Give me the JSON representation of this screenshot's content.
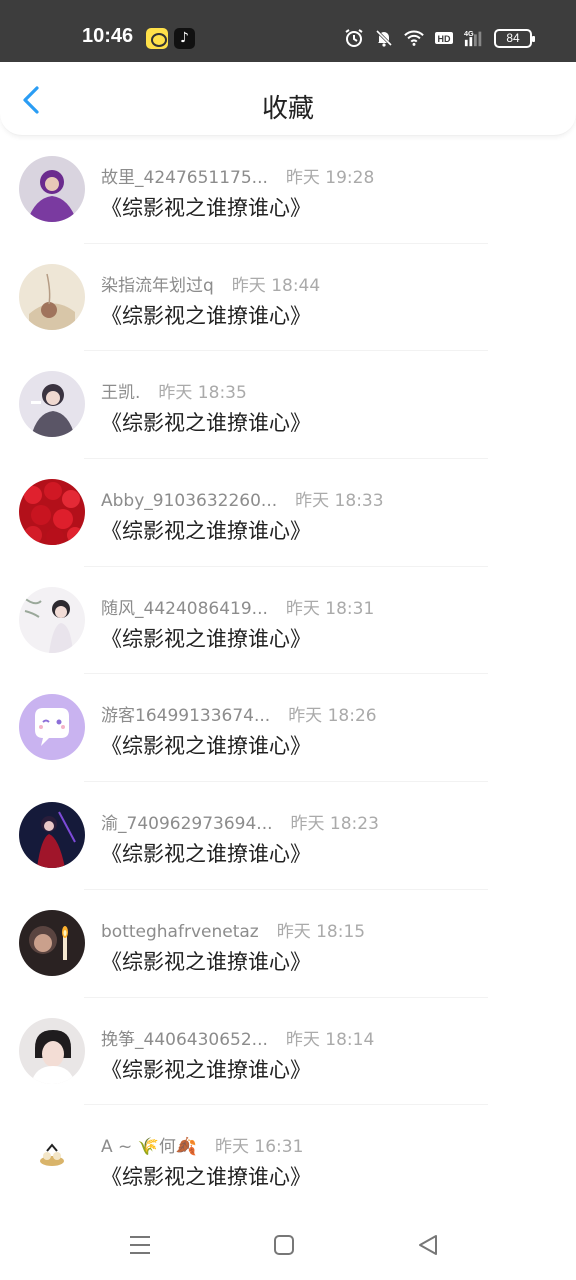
{
  "status_bar": {
    "time": "10:46",
    "battery": "84",
    "icons": [
      "notes-app-icon",
      "tiktok-icon",
      "alarm-icon",
      "mute-bell-icon",
      "wifi-icon",
      "hd-icon",
      "signal-4g-icon",
      "battery-icon"
    ]
  },
  "header": {
    "title": "收藏",
    "back_icon": "chevron-left-icon"
  },
  "colors": {
    "accent": "#2a9df4",
    "status_bar_bg": "#3d3d3d",
    "username": "#8c8c8c",
    "time": "#aaaaaa",
    "title_text": "#222222"
  },
  "items": [
    {
      "username": "故里_4247651175...",
      "time": "昨天 19:28",
      "title": "《综影视之谁撩谁心》"
    },
    {
      "username": "染指流年划过q",
      "time": "昨天 18:44",
      "title": "《综影视之谁撩谁心》"
    },
    {
      "username": "王凯.",
      "time": "昨天 18:35",
      "title": "《综影视之谁撩谁心》"
    },
    {
      "username": "Abby_9103632260...",
      "time": "昨天 18:33",
      "title": "《综影视之谁撩谁心》"
    },
    {
      "username": "随风_4424086419...",
      "time": "昨天 18:31",
      "title": "《综影视之谁撩谁心》"
    },
    {
      "username": "游客16499133674...",
      "time": "昨天 18:26",
      "title": "《综影视之谁撩谁心》"
    },
    {
      "username": "渝_740962973694...",
      "time": "昨天 18:23",
      "title": "《综影视之谁撩谁心》"
    },
    {
      "username": "botteghafrvenetaz",
      "time": "昨天 18:15",
      "title": "《综影视之谁撩谁心》"
    },
    {
      "username": "挽筝_4406430652...",
      "time": "昨天 18:14",
      "title": "《综影视之谁撩谁心》"
    },
    {
      "username": "A ~ 🌾何🍂",
      "time": "昨天 16:31",
      "title": "《综影视之谁撩谁心》"
    }
  ],
  "nav": {
    "icons": [
      "menu-icon",
      "home-square-icon",
      "back-triangle-icon"
    ]
  }
}
